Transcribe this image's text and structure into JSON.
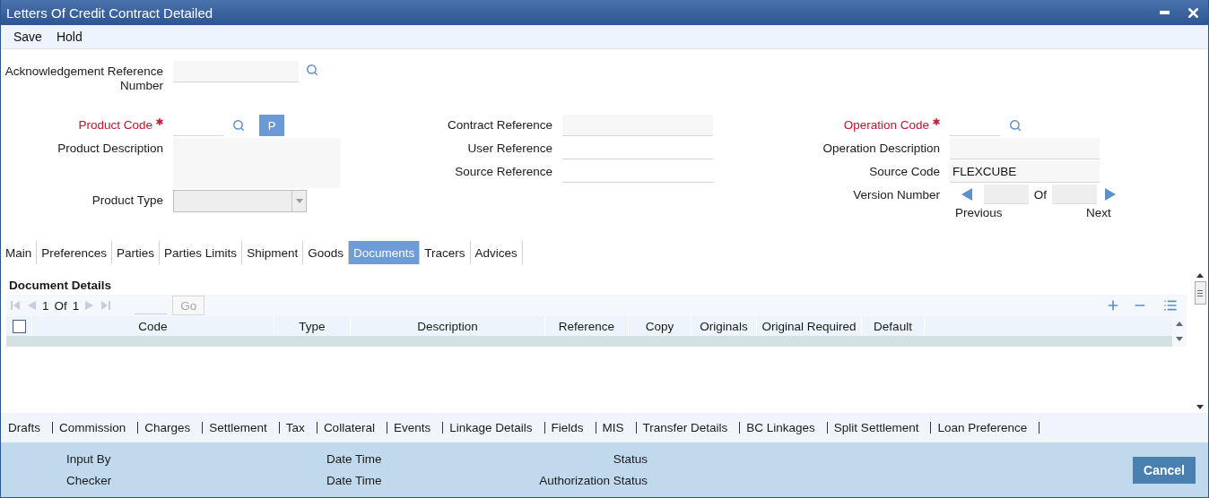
{
  "window": {
    "title": "Letters Of Credit Contract Detailed"
  },
  "toolbar": [
    "Save",
    "Hold"
  ],
  "acknowledgement": {
    "label": "Acknowledgement Reference Number"
  },
  "columns": [
    [
      {
        "kind": "lookup",
        "label": "Product Code",
        "required": true,
        "button": "P"
      },
      {
        "kind": "textarea",
        "label": "Product Description",
        "required": false
      },
      {
        "kind": "select",
        "label": "Product Type",
        "required": false,
        "disabled": true
      }
    ],
    [
      {
        "kind": "readonly",
        "label": "Contract Reference",
        "required": false
      },
      {
        "kind": "text",
        "label": "User Reference",
        "required": false
      },
      {
        "kind": "text",
        "label": "Source Reference",
        "required": false
      }
    ],
    [
      {
        "kind": "lookup",
        "label": "Operation Code",
        "required": true
      },
      {
        "kind": "readonly",
        "label": "Operation Description",
        "required": false
      },
      {
        "kind": "readonly",
        "label": "Source Code",
        "required": false,
        "value": "FLEXCUBE"
      },
      {
        "kind": "version",
        "label": "Version Number",
        "required": false,
        "of": "Of",
        "previous": "Previous",
        "next": "Next"
      }
    ]
  ],
  "tabs": [
    {
      "label": "Main",
      "selected": false
    },
    {
      "label": "Preferences",
      "selected": false
    },
    {
      "label": "Parties",
      "selected": false
    },
    {
      "label": "Parties Limits",
      "selected": false
    },
    {
      "label": "Shipment",
      "selected": false
    },
    {
      "label": "Goods",
      "selected": false
    },
    {
      "label": "Documents",
      "selected": true
    },
    {
      "label": "Tracers",
      "selected": false
    },
    {
      "label": "Advices",
      "selected": false
    }
  ],
  "documents": {
    "title": "Document Details",
    "pager": {
      "page": "1",
      "of": "Of",
      "total": "1",
      "go": "Go"
    },
    "all_checked": false,
    "columns": [
      "Code",
      "Type",
      "Description",
      "Reference",
      "Copy",
      "Originals",
      "Original Required",
      "Default"
    ]
  },
  "links": [
    "Drafts",
    "Commission",
    "Charges",
    "Settlement",
    "Tax",
    "Collateral",
    "Events",
    "Linkage Details",
    "Fields",
    "MIS",
    "Transfer Details",
    "BC Linkages",
    "Split Settlement",
    "Loan Preference"
  ],
  "footer": {
    "rows": [
      [
        "Input By",
        "Date Time",
        "Status"
      ],
      [
        "Checker",
        "Date Time",
        "Authorization Status"
      ]
    ],
    "cancel": "Cancel"
  }
}
